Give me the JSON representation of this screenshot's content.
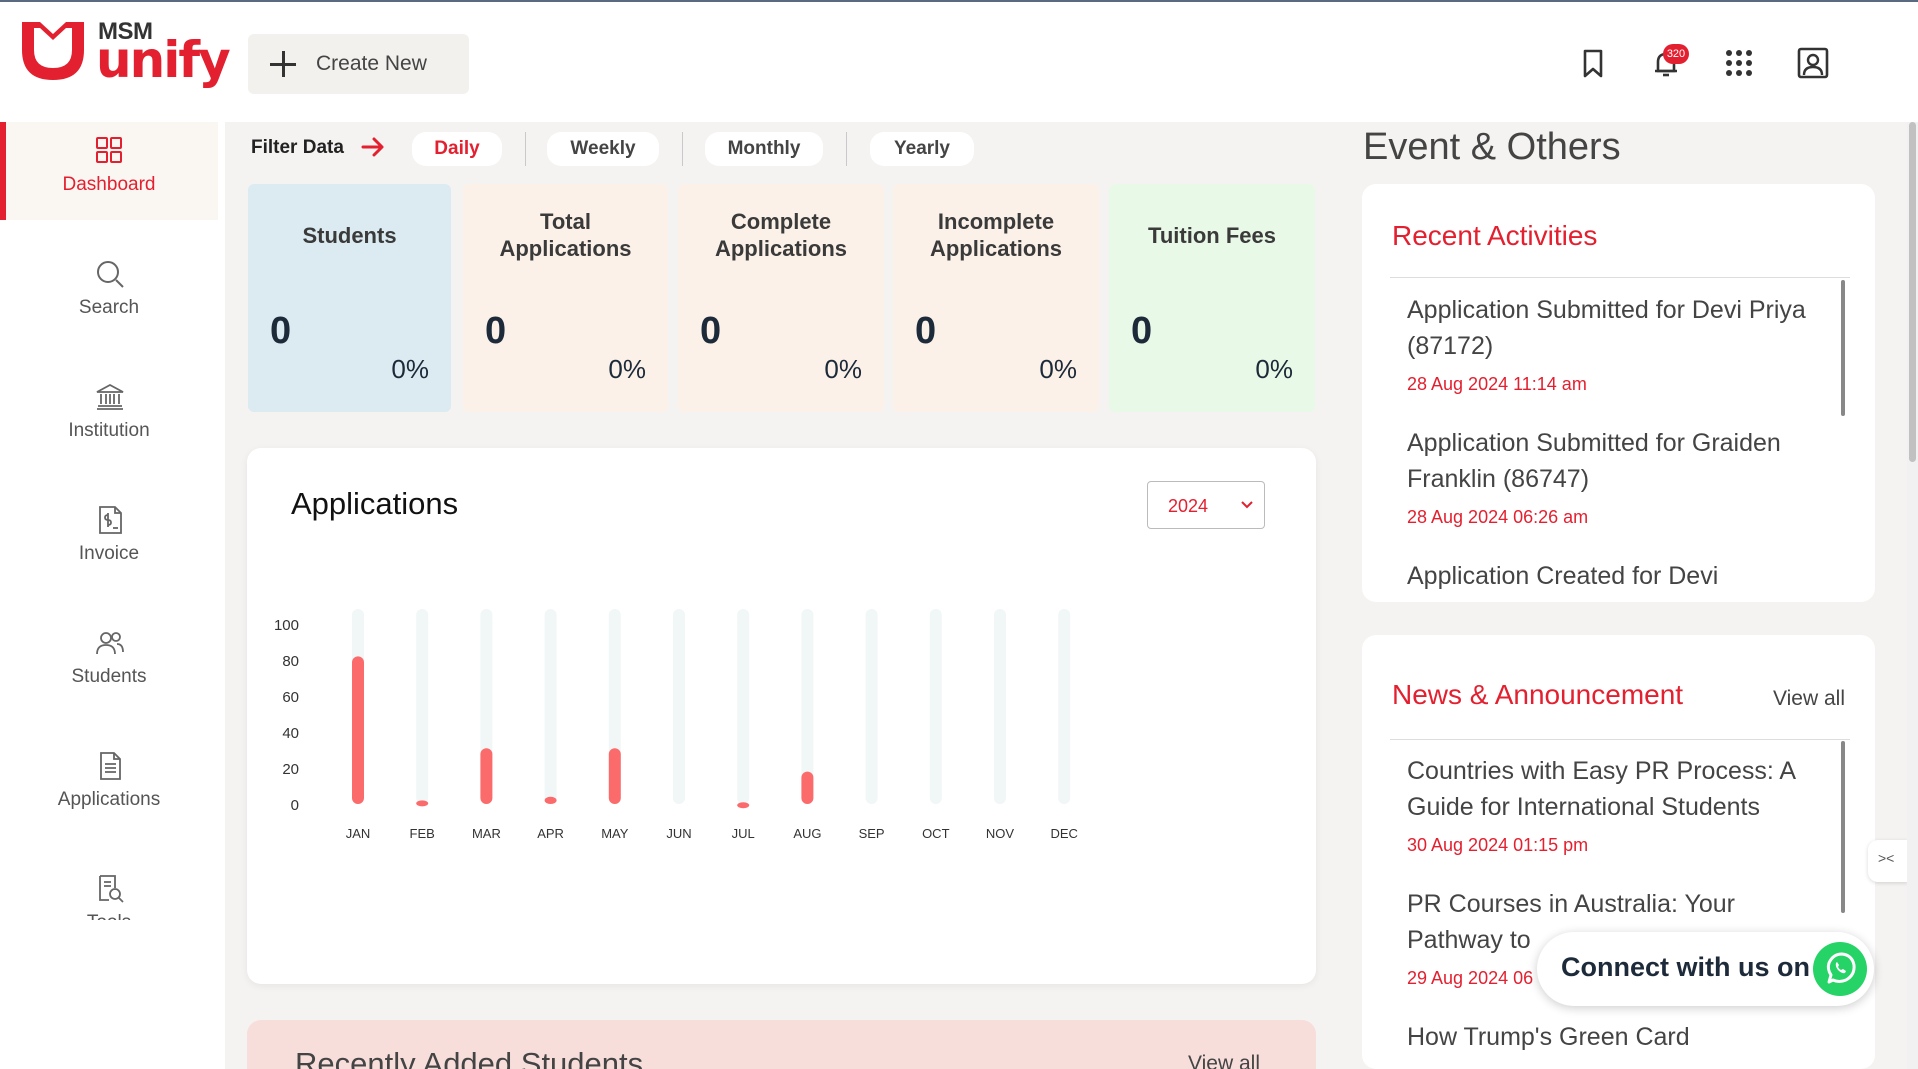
{
  "brand": {
    "top": "MSM",
    "name": "unify",
    "color": "#e3202f"
  },
  "header": {
    "create_label": "Create New",
    "notification_count": "320",
    "icons": [
      "bookmark-icon",
      "bell-icon",
      "apps-grid-icon",
      "user-profile-icon"
    ]
  },
  "sidebar": {
    "items": [
      {
        "label": "Dashboard",
        "icon": "dashboard-grid-icon",
        "active": true
      },
      {
        "label": "Search",
        "icon": "search-icon",
        "active": false
      },
      {
        "label": "Institution",
        "icon": "institution-icon",
        "active": false
      },
      {
        "label": "Invoice",
        "icon": "invoice-icon",
        "active": false
      },
      {
        "label": "Students",
        "icon": "students-icon",
        "active": false
      },
      {
        "label": "Applications",
        "icon": "applications-icon",
        "active": false
      },
      {
        "label": "Tools",
        "icon": "tools-icon",
        "active": false
      }
    ]
  },
  "filter": {
    "label": "Filter Data",
    "options": [
      "Daily",
      "Weekly",
      "Monthly",
      "Yearly"
    ],
    "selected": "Daily"
  },
  "stats": [
    {
      "title": "Students",
      "value": "0",
      "percent": "0%",
      "color": "#dbebf1"
    },
    {
      "title": "Total Applications",
      "value": "0",
      "percent": "0%",
      "color": "#fbf1e8"
    },
    {
      "title": "Complete Applications",
      "value": "0",
      "percent": "0%",
      "color": "#fbf1e8"
    },
    {
      "title": "Incomplete Applications",
      "value": "0",
      "percent": "0%",
      "color": "#fbf1e8"
    },
    {
      "title": "Tuition Fees",
      "value": "0",
      "percent": "0%",
      "color": "#e9f9e7"
    }
  ],
  "applications_card": {
    "title": "Applications",
    "year": "2024"
  },
  "chart_data": {
    "type": "bar",
    "categories": [
      "JAN",
      "FEB",
      "MAR",
      "APR",
      "MAY",
      "JUN",
      "JUL",
      "AUG",
      "SEP",
      "OCT",
      "NOV",
      "DEC"
    ],
    "values": [
      82,
      2,
      31,
      4,
      31,
      0,
      1,
      18,
      0,
      0,
      0,
      0
    ],
    "yticks": [
      0,
      20,
      40,
      60,
      80,
      100
    ],
    "ylim": [
      0,
      100
    ],
    "bar_color": "#fb6b6b",
    "track_color": "#f1f6f7",
    "grid": false
  },
  "recent_students": {
    "title": "Recently Added Students",
    "view_all": "View all"
  },
  "events": {
    "title": "Event & Others",
    "recent_activities": {
      "title": "Recent Activities",
      "items": [
        {
          "title": "Application Submitted for Devi Priya (87172)",
          "date": "28 Aug 2024 11:14 am"
        },
        {
          "title": "Application Submitted for Graiden Franklin (86747)",
          "date": "28 Aug 2024 06:26 am"
        },
        {
          "title": "Application Created for Devi",
          "date": ""
        }
      ]
    },
    "news": {
      "title": "News & Announcement",
      "view_all": "View all",
      "items": [
        {
          "title": "Countries with Easy PR Process: A Guide for International Students",
          "date": "30 Aug 2024 01:15 pm"
        },
        {
          "title": "PR Courses in Australia: Your Pathway to",
          "date": "29 Aug 2024 06"
        },
        {
          "title": "How Trump's Green Card",
          "date": ""
        }
      ]
    }
  },
  "connect": {
    "label": "Connect with us on",
    "icon": "whatsapp-icon"
  }
}
